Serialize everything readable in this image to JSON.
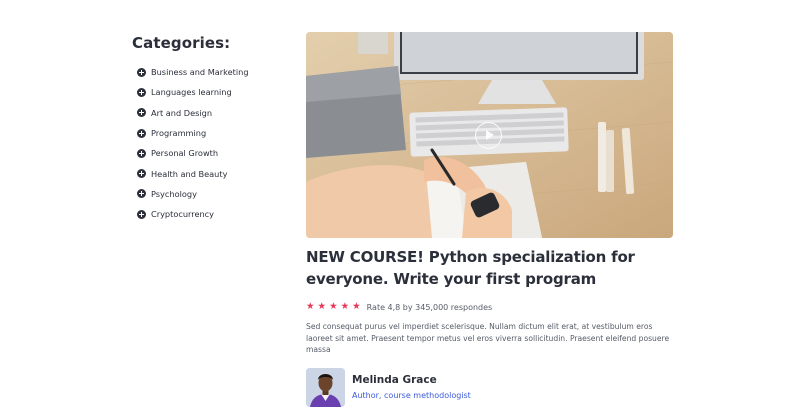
{
  "sidebar": {
    "title": "Categories:",
    "items": [
      {
        "label": "Business and Marketing"
      },
      {
        "label": "Languages learning"
      },
      {
        "label": "Art and Design"
      },
      {
        "label": "Programming"
      },
      {
        "label": "Personal Growth"
      },
      {
        "label": "Health and Beauty"
      },
      {
        "label": "Psychology"
      },
      {
        "label": "Cryptocurrency"
      }
    ]
  },
  "course": {
    "title": "NEW COURSE! Python specialization for everyone. Write your first program",
    "rating": {
      "stars": 5,
      "text": "Rate 4,8 by 345,000 respondes",
      "star_color": "#e8385a"
    },
    "description": "Sed consequat purus vel imperdiet scelerisque. Nullam dictum elit erat, at vestibulum eros laoreet sit amet. Praesent tempor metus vel eros viverra sollicitudin. Praesent eleifend posuere massa",
    "author": {
      "name": "Melinda Grace",
      "role": "Author, course methodologist",
      "role_color": "#3b5bdb"
    }
  }
}
